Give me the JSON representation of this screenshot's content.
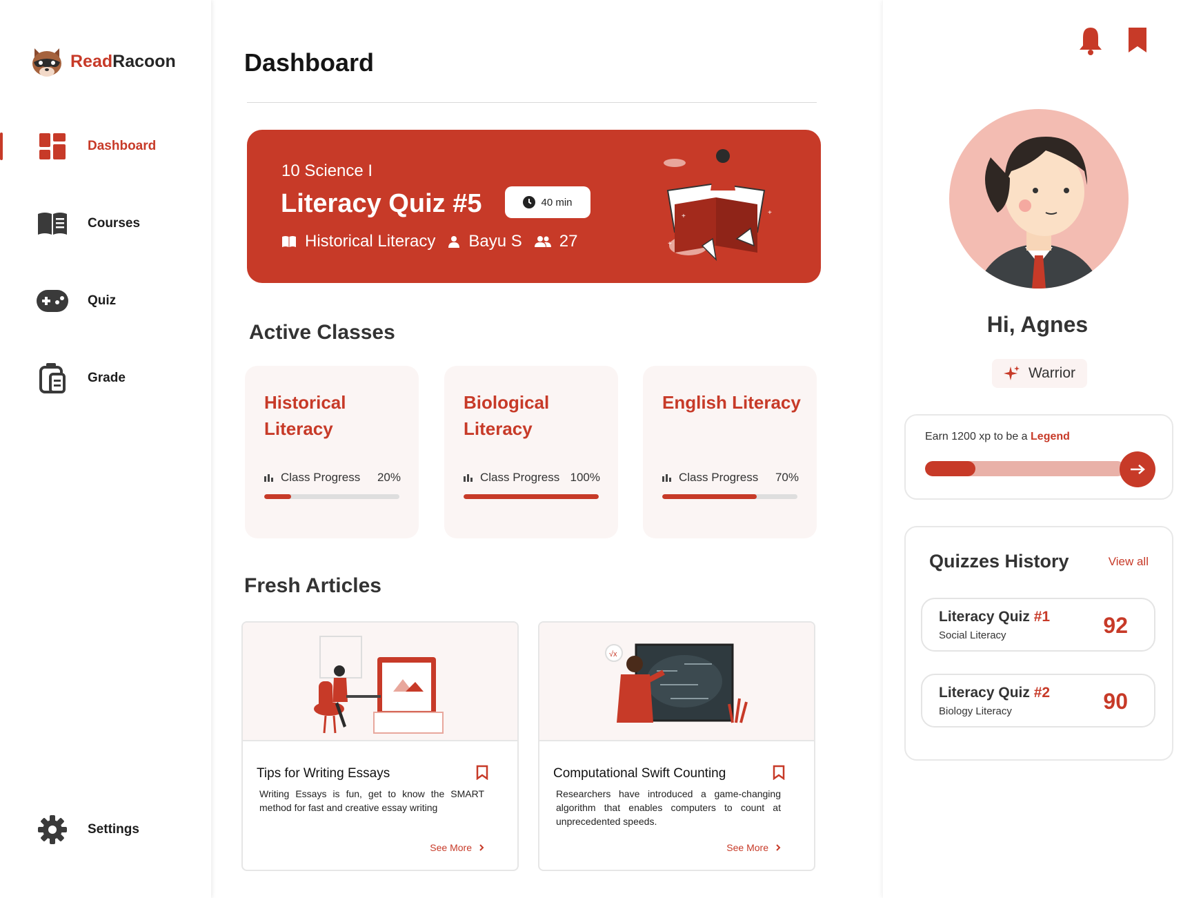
{
  "brand": {
    "name_part1": "Read",
    "name_part2": "Racoon"
  },
  "sidebar": {
    "items": [
      {
        "label": "Dashboard",
        "icon": "dashboard-icon",
        "active": true
      },
      {
        "label": "Courses",
        "icon": "book-icon"
      },
      {
        "label": "Quiz",
        "icon": "gamepad-icon"
      },
      {
        "label": "Grade",
        "icon": "clipboard-icon"
      }
    ],
    "settings_label": "Settings"
  },
  "page": {
    "title": "Dashboard"
  },
  "hero": {
    "class_name": "10 Science I",
    "quiz_title": "Literacy Quiz #5",
    "duration": "40 min",
    "course": "Historical Literacy",
    "teacher": "Bayu S",
    "participants": "27"
  },
  "active_classes": {
    "title": "Active Classes",
    "items": [
      {
        "name": "Historical Literacy",
        "progress_label": "Class Progress",
        "progress_text": "20%",
        "progress": 0.2
      },
      {
        "name": "Biological Literacy",
        "progress_label": "Class Progress",
        "progress_text": "100%",
        "progress": 1.0
      },
      {
        "name": "English Literacy",
        "progress_label": "Class Progress",
        "progress_text": "70%",
        "progress": 0.7
      }
    ]
  },
  "articles": {
    "title": "Fresh Articles",
    "items": [
      {
        "title": "Tips for Writing Essays",
        "desc": "Writing Essays is fun, get to know the SMART method for fast and creative essay writing",
        "more": "See More"
      },
      {
        "title": "Computational Swift Counting",
        "desc": "Researchers have introduced a game-changing algorithm that enables computers to count at unprecedented speeds.",
        "more": "See More"
      }
    ]
  },
  "profile": {
    "greeting": "Hi, Agnes",
    "rank": "Warrior",
    "xp_text": "Earn 1200 xp to be a",
    "xp_target": "Legend",
    "xp_progress": 0.25
  },
  "quiz_history": {
    "title": "Quizzes History",
    "view_all": "View all",
    "items": [
      {
        "name": "Literacy Quiz",
        "number": "#1",
        "subject": "Social Literacy",
        "score": "92"
      },
      {
        "name": "Literacy Quiz",
        "number": "#2",
        "subject": "Biology Literacy",
        "score": "90"
      }
    ]
  },
  "colors": {
    "accent": "#C73A28",
    "card_bg": "#FBF5F4",
    "avatar_bg": "#F3BCB2"
  }
}
